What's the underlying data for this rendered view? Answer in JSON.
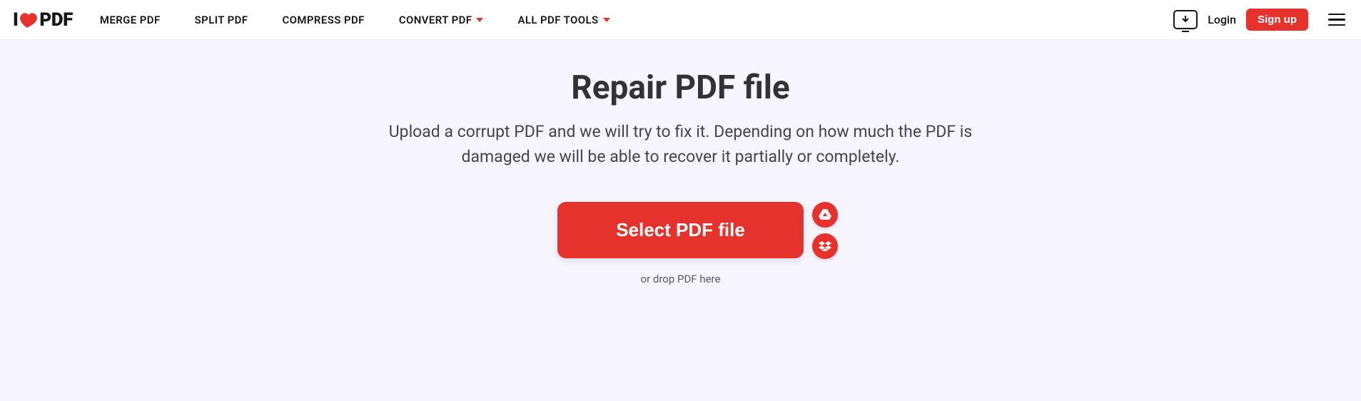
{
  "logo": {
    "prefix": "I",
    "suffix": "PDF"
  },
  "nav": {
    "merge": "MERGE PDF",
    "split": "SPLIT PDF",
    "compress": "COMPRESS PDF",
    "convert": "CONVERT PDF",
    "allTools": "ALL PDF TOOLS"
  },
  "auth": {
    "login": "Login",
    "signup": "Sign up"
  },
  "page": {
    "title": "Repair PDF file",
    "subtitle": "Upload a corrupt PDF and we will try to fix it. Depending on how much the PDF is damaged we will be able to recover it partially or completely.",
    "selectBtn": "Select PDF file",
    "dropText": "or drop PDF here"
  }
}
